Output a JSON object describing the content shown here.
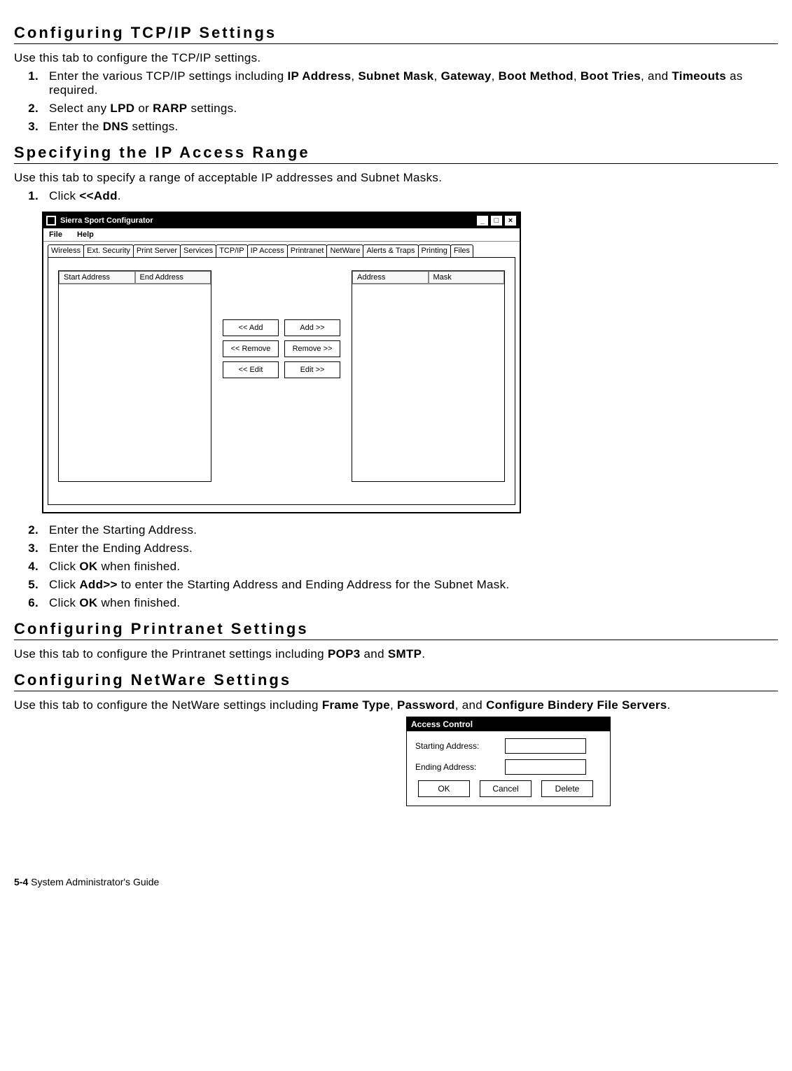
{
  "headings": {
    "tcpip": "Configuring TCP/IP Settings",
    "iprange": "Specifying the IP Access Range",
    "printranet": "Configuring Printranet Settings",
    "netware": "Configuring NetWare Settings"
  },
  "tcpip": {
    "intro": "Use this tab to configure the TCP/IP settings.",
    "steps": {
      "s1a": "Enter the various TCP/IP settings including ",
      "s1b_ip": "IP Address",
      "s1c": ", ",
      "s1d_subnet": "Subnet Mask",
      "s1e": ", ",
      "s1f_gateway": "Gateway",
      "s1g": ", ",
      "s1h_boot": "Boot Method",
      "s1i": ", ",
      "s1j_tries": "Boot Tries",
      "s1k": ", and ",
      "s1l_timeouts": "Timeouts",
      "s1m": " as required.",
      "s2a": "Select any ",
      "s2b_lpd": "LPD",
      "s2c": " or ",
      "s2d_rarp": "RARP",
      "s2e": " settings.",
      "s3a": "Enter the ",
      "s3b_dns": "DNS",
      "s3c": " settings."
    }
  },
  "iprange": {
    "intro": "Use this tab to specify a range of acceptable IP addresses and Subnet Masks.",
    "step1a": "Click ",
    "step1b_add": "<<Add",
    "step1c": ".",
    "step2": "Enter the Starting Address.",
    "step3": "Enter the Ending Address.",
    "step4a": "Click ",
    "step4b_ok": "OK",
    "step4c": " when finished.",
    "step5a": "Click ",
    "step5b_add": "Add>>",
    "step5c": " to enter the Starting Address and Ending Address for the Subnet Mask.",
    "step6a": "Click ",
    "step6b_ok": "OK",
    "step6c": " when finished."
  },
  "printranet": {
    "intro_a": "Use this tab to configure the Printranet settings including ",
    "pop3": "POP3",
    "and": " and ",
    "smtp": "SMTP",
    "period": "."
  },
  "netware": {
    "intro_a": "Use this tab to configure the NetWare settings including ",
    "frame": "Frame Type",
    "c1": ", ",
    "pwd": "Password",
    "c2": ", and ",
    "bindery": "Configure Bindery File Servers",
    "period": "."
  },
  "app": {
    "title": "Sierra Sport Configurator",
    "menu": {
      "file": "File",
      "help": "Help"
    },
    "tabs": [
      "Wireless",
      "Ext. Security",
      "Print Server",
      "Services",
      "TCP/IP",
      "IP Access",
      "Printranet",
      "NetWare",
      "Alerts & Traps",
      "Printing",
      "Files"
    ],
    "left_cols": {
      "start": "Start Address",
      "end": "End Address"
    },
    "right_cols": {
      "addr": "Address",
      "mask": "Mask"
    },
    "buttons": {
      "addL": "<< Add",
      "addR": "Add >>",
      "remL": "<< Remove",
      "remR": "Remove >>",
      "editL": "<< Edit",
      "editR": "Edit >>"
    },
    "win": {
      "min": "_",
      "max": "□",
      "close": "×"
    }
  },
  "access_dialog": {
    "title": "Access Control",
    "start_label": "Starting Address:",
    "end_label": "Ending Address:",
    "ok": "OK",
    "cancel": "Cancel",
    "delete": "Delete"
  },
  "footer": {
    "page": "5-4",
    "title": "  System Administrator's Guide"
  }
}
